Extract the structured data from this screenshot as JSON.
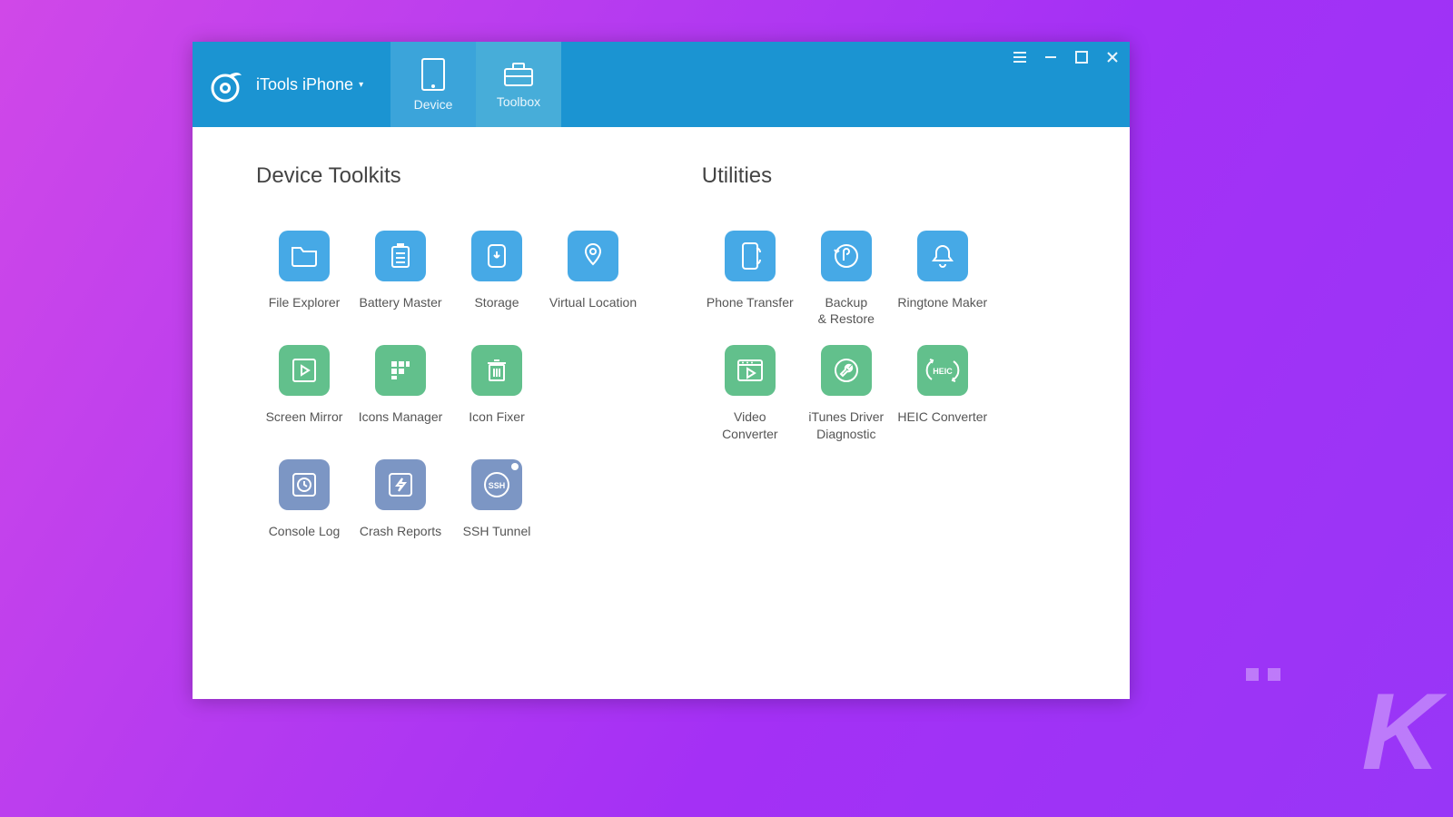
{
  "header": {
    "brand_title": "iTools iPhone",
    "tabs": [
      {
        "label": "Device",
        "active": false
      },
      {
        "label": "Toolbox",
        "active": true
      }
    ]
  },
  "sections": {
    "device_toolkits": {
      "title": "Device Toolkits",
      "items": [
        {
          "label": "File Explorer",
          "icon": "folder-icon",
          "tint": "blue"
        },
        {
          "label": "Battery Master",
          "icon": "battery-icon",
          "tint": "blue"
        },
        {
          "label": "Storage",
          "icon": "storage-icon",
          "tint": "blue"
        },
        {
          "label": "Virtual Location",
          "icon": "location-icon",
          "tint": "blue"
        },
        {
          "label": "Screen Mirror",
          "icon": "play-icon",
          "tint": "green"
        },
        {
          "label": "Icons Manager",
          "icon": "grid-icon",
          "tint": "green"
        },
        {
          "label": "Icon Fixer",
          "icon": "trash-icon",
          "tint": "green"
        },
        {
          "label": "",
          "icon": "",
          "tint": ""
        },
        {
          "label": "Console Log",
          "icon": "clock-icon",
          "tint": "slate"
        },
        {
          "label": "Crash Reports",
          "icon": "bolt-icon",
          "tint": "slate"
        },
        {
          "label": "SSH Tunnel",
          "icon": "ssh-icon",
          "tint": "slate"
        }
      ]
    },
    "utilities": {
      "title": "Utilities",
      "items": [
        {
          "label": "Phone Transfer",
          "icon": "phone-transfer-icon",
          "tint": "blue"
        },
        {
          "label": "Backup\n& Restore",
          "icon": "backup-icon",
          "tint": "blue"
        },
        {
          "label": "Ringtone Maker",
          "icon": "bell-icon",
          "tint": "blue"
        },
        {
          "label": "Video\nConverter",
          "icon": "video-icon",
          "tint": "green"
        },
        {
          "label": "iTunes Driver\nDiagnostic",
          "icon": "wrench-icon",
          "tint": "green"
        },
        {
          "label": "HEIC Converter",
          "icon": "heic-icon",
          "tint": "green"
        }
      ]
    }
  }
}
